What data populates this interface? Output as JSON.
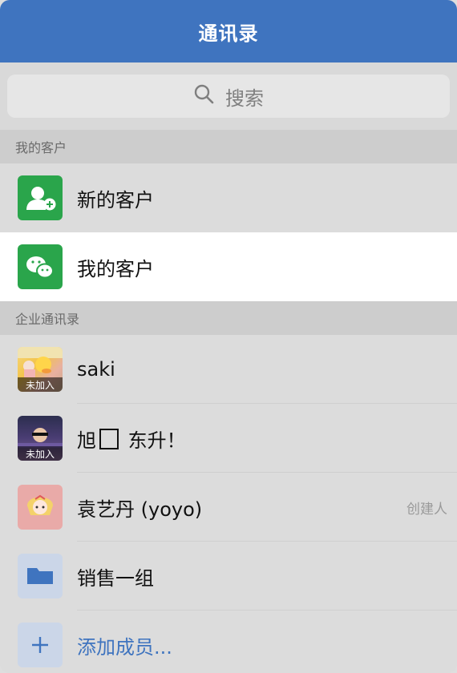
{
  "header": {
    "title": "通讯录"
  },
  "search": {
    "placeholder": "搜索"
  },
  "sections": {
    "customers": "我的客户",
    "company": "企业通讯录"
  },
  "customer_items": [
    {
      "label": "新的客户",
      "icon": "add-customer-icon",
      "color": "#2aa54b"
    },
    {
      "label": "我的客户",
      "icon": "wechat-icon",
      "color": "#2aa54b"
    }
  ],
  "members": [
    {
      "name": "saki",
      "badge": "未加入"
    },
    {
      "name_prefix": "旭",
      "name_suffix": "东升！",
      "badge": "未加入"
    },
    {
      "name": "袁艺丹 (yoyo)",
      "tag": "创建人"
    },
    {
      "name": "销售一组",
      "icon": "folder-icon"
    }
  ],
  "add_member": {
    "label": "添加成员..."
  }
}
